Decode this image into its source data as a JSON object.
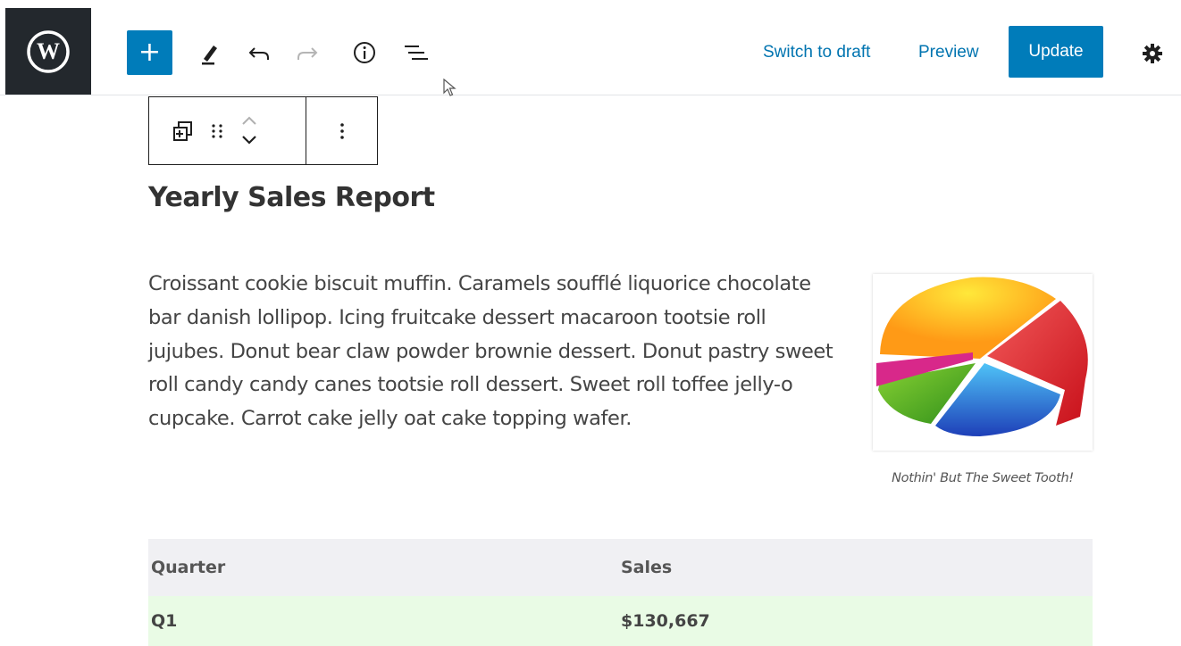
{
  "toolbar": {
    "add_label": "+",
    "switch_draft_label": "Switch to draft",
    "preview_label": "Preview",
    "update_label": "Update"
  },
  "icons": {
    "logo": "wordpress-logo-icon",
    "pen": "pen-tool-icon",
    "undo": "undo-icon",
    "redo": "redo-icon",
    "info": "info-icon",
    "outline": "list-view-icon",
    "settings": "gear-icon",
    "transform": "block-transform-icon",
    "drag": "drag-handle-icon",
    "move": "move-up-down-icon",
    "more": "more-options-icon"
  },
  "content": {
    "heading": "Yearly Sales Report",
    "paragraph": "Croissant cookie biscuit muffin. Caramels soufflé liquorice chocolate bar danish lollipop. Icing fruitcake dessert macaroon tootsie roll jujubes. Donut bear claw powder brownie dessert. Donut pastry sweet roll candy candy canes tootsie roll dessert. Sweet roll toffee jelly-o cupcake. Carrot cake jelly oat cake topping wafer.",
    "image_caption": "Nothin' But The Sweet Tooth!"
  },
  "table": {
    "headers": [
      "Quarter",
      "Sales"
    ],
    "rows": [
      [
        "Q1",
        "$130,667"
      ]
    ]
  },
  "colors": {
    "accent": "#007cba",
    "logo_bg": "#23282d",
    "table_header_bg": "#f0f0f3",
    "table_row_bg": "#e9fbe5"
  }
}
